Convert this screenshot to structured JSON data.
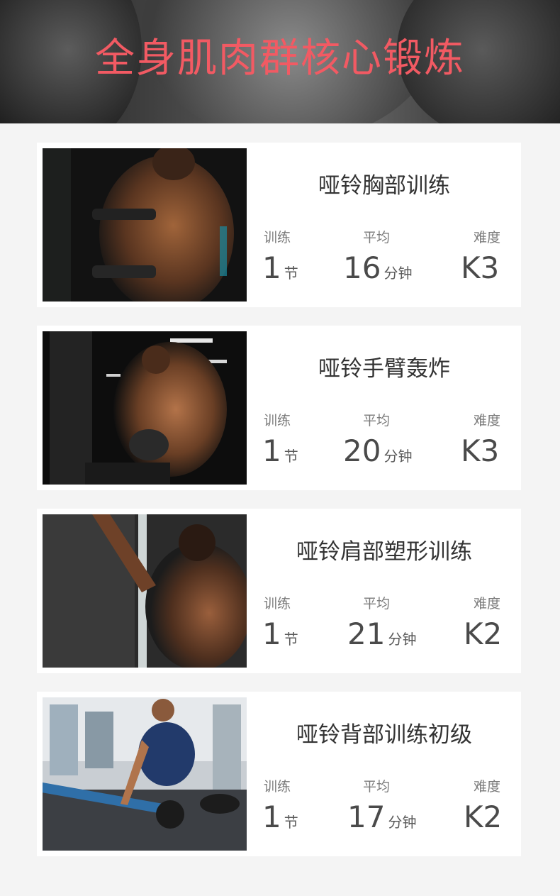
{
  "banner": {
    "title": "全身肌肉群核心锻炼"
  },
  "courses": [
    {
      "title": "哑铃胸部训练",
      "train_label": "训练",
      "sessions": "1",
      "sessions_unit": "节",
      "avg_label": "平均",
      "minutes": "16",
      "minutes_unit": "分钟",
      "difficulty_label": "难度",
      "difficulty": "K3",
      "photo_icon": "chest-workout-photo"
    },
    {
      "title": "哑铃手臂轰炸",
      "train_label": "训练",
      "sessions": "1",
      "sessions_unit": "节",
      "avg_label": "平均",
      "minutes": "20",
      "minutes_unit": "分钟",
      "difficulty_label": "难度",
      "difficulty": "K3",
      "photo_icon": "arm-workout-photo"
    },
    {
      "title": "哑铃肩部塑形训练",
      "train_label": "训练",
      "sessions": "1",
      "sessions_unit": "节",
      "avg_label": "平均",
      "minutes": "21",
      "minutes_unit": "分钟",
      "difficulty_label": "难度",
      "difficulty": "K2",
      "photo_icon": "shoulder-workout-photo"
    },
    {
      "title": "哑铃背部训练初级",
      "train_label": "训练",
      "sessions": "1",
      "sessions_unit": "节",
      "avg_label": "平均",
      "minutes": "17",
      "minutes_unit": "分钟",
      "difficulty_label": "难度",
      "difficulty": "K2",
      "photo_icon": "back-workout-photo"
    }
  ],
  "colors": {
    "title_accent": "#f25a63",
    "page_bg": "#f4f4f4",
    "card_bg": "#ffffff",
    "text_main": "#333333",
    "text_muted": "#7a7a7a"
  }
}
